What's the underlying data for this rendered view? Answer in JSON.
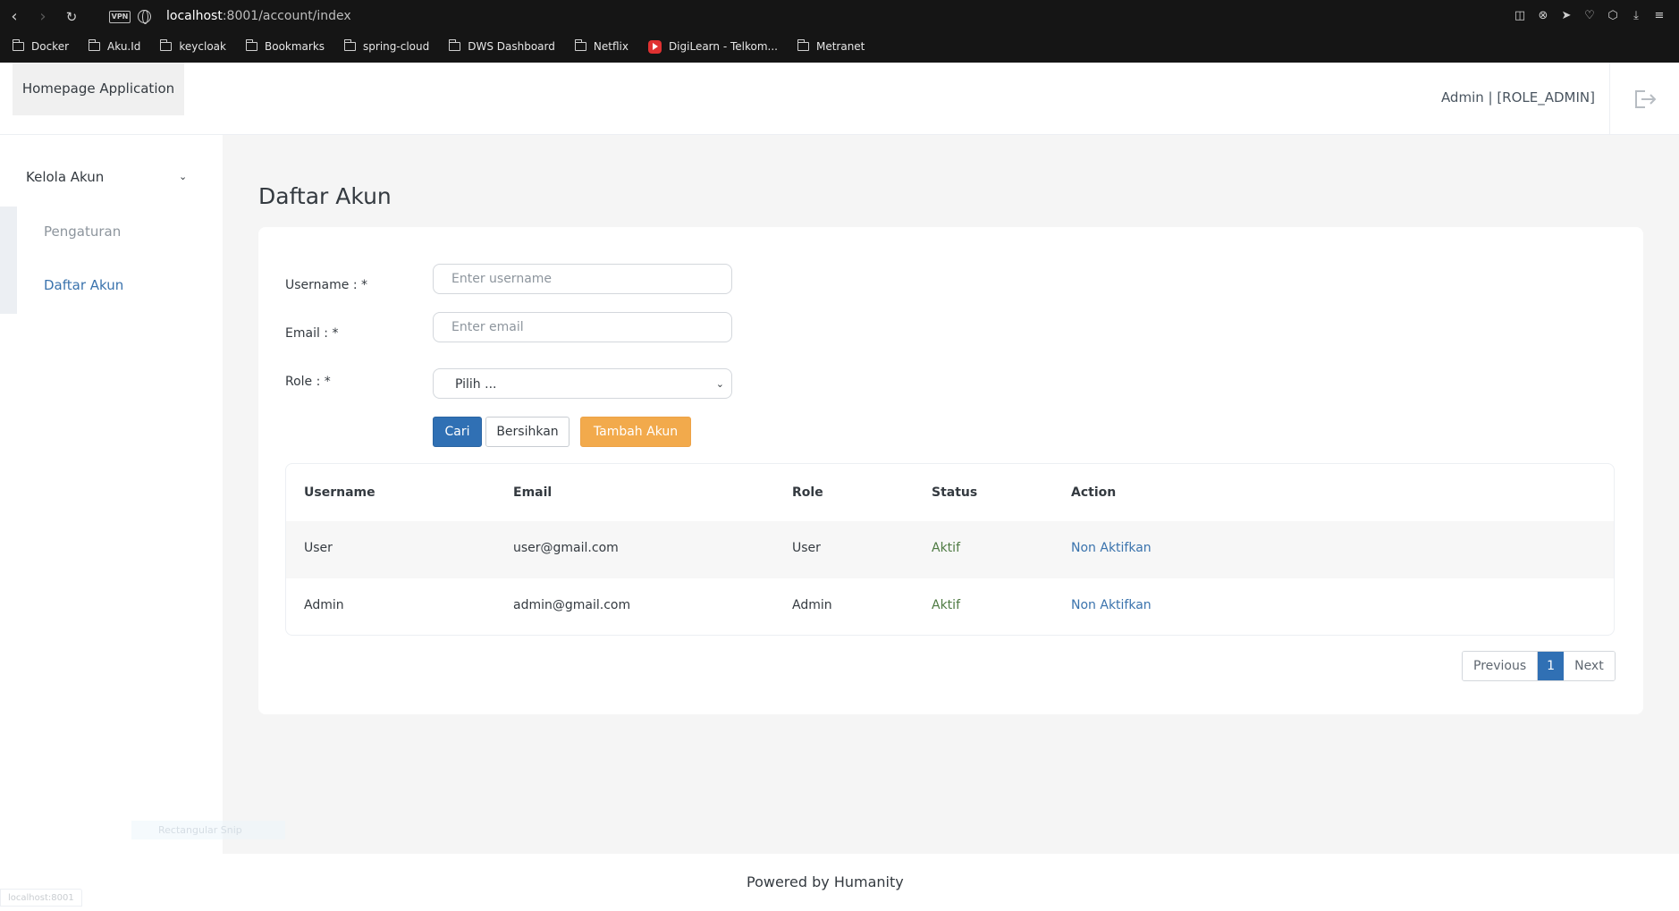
{
  "browser": {
    "url_host": "localhost",
    "url_path": ":8001/account/index",
    "vpn_label": "VPN",
    "bookmarks": [
      {
        "label": "Docker",
        "icon": "folder-icon"
      },
      {
        "label": "Aku.Id",
        "icon": "folder-icon"
      },
      {
        "label": "keycloak",
        "icon": "folder-icon"
      },
      {
        "label": "Bookmarks",
        "icon": "folder-icon"
      },
      {
        "label": "spring-cloud",
        "icon": "folder-icon"
      },
      {
        "label": "DWS Dashboard",
        "icon": "folder-icon"
      },
      {
        "label": "Netflix",
        "icon": "folder-icon"
      },
      {
        "label": "DigiLearn - Telkom...",
        "icon": "youtube-icon"
      },
      {
        "label": "Metranet",
        "icon": "folder-icon"
      }
    ],
    "status_url": "localhost:8001"
  },
  "header": {
    "brand": "Homepage Application",
    "user": "Admin | [ROLE_ADMIN]"
  },
  "sidebar": {
    "group": "Kelola Akun",
    "items": [
      {
        "label": "Pengaturan",
        "color": "#8d959d"
      },
      {
        "label": "Daftar Akun",
        "color": "#3a73ad"
      }
    ],
    "ghost_tooltip": "Rectangular Snip"
  },
  "main": {
    "title": "Daftar Akun",
    "form": {
      "username_label": "Username : *",
      "username_placeholder": "Enter username",
      "email_label": "Email : *",
      "email_placeholder": "Enter email",
      "role_label": "Role : *",
      "role_selected": "Pilih ..."
    },
    "buttons": {
      "search": "Cari",
      "clear": "Bersihkan",
      "add": "Tambah Akun"
    },
    "table": {
      "headers": [
        "Username",
        "Email",
        "Role",
        "Status",
        "Action"
      ],
      "rows": [
        {
          "username": "User",
          "email": "user@gmail.com",
          "role": "User",
          "status": "Aktif",
          "action": "Non Aktifkan"
        },
        {
          "username": "Admin",
          "email": "admin@gmail.com",
          "role": "Admin",
          "status": "Aktif",
          "action": "Non Aktifkan"
        }
      ]
    },
    "pagination": {
      "previous": "Previous",
      "current": "1",
      "next": "Next"
    }
  },
  "footer": {
    "text": "Powered by Humanity"
  },
  "colors": {
    "primary": "#3070b4",
    "warning": "#f2aa4c",
    "status_active": "#4e7a42",
    "link": "#3a73ad"
  }
}
